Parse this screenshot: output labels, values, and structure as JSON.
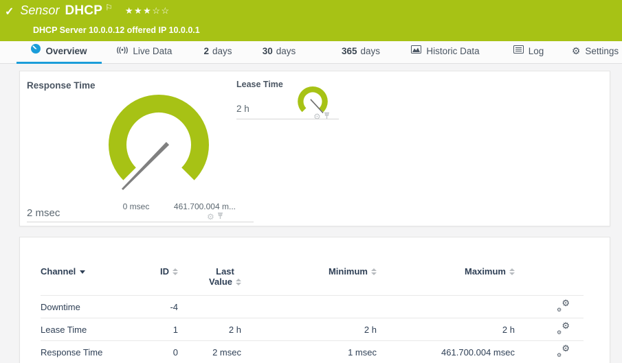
{
  "header": {
    "status_icon": "✓",
    "kind": "Sensor",
    "name": "DHCP",
    "flag_icon": "⚐",
    "stars_filled": "★★★",
    "stars_empty": "☆☆",
    "subtitle": "DHCP Server 10.0.0.12 offered IP 10.0.0.1",
    "status_color": "#a7c215"
  },
  "tabs": {
    "overview": "Overview",
    "live_data": "Live Data",
    "d2_num": "2",
    "d2_label": "days",
    "d30_num": "30",
    "d30_label": "days",
    "d365_num": "365",
    "d365_label": "days",
    "historic": "Historic Data",
    "log": "Log",
    "settings": "Settings",
    "active_tab": "Overview",
    "accent_color": "#1b9dd9"
  },
  "gauges": {
    "response_time": {
      "title": "Response Time",
      "value": "2 msec",
      "scale_min": "0 msec",
      "scale_max": "461.700.004 m...",
      "color": "#a7c215"
    },
    "lease_time": {
      "title": "Lease Time",
      "value": "2 h",
      "color": "#a7c215"
    }
  },
  "channel_table": {
    "headers": {
      "channel": "Channel",
      "id": "ID",
      "last1": "Last",
      "last2": "Value",
      "minimum": "Minimum",
      "maximum": "Maximum"
    },
    "rows": [
      {
        "channel": "Downtime",
        "id": "-4",
        "last": "",
        "min": "",
        "max": ""
      },
      {
        "channel": "Lease Time",
        "id": "1",
        "last": "2 h",
        "min": "2 h",
        "max": "2 h"
      },
      {
        "channel": "Response Time",
        "id": "0",
        "last": "2 msec",
        "min": "1 msec",
        "max": "461.700.004 msec"
      }
    ]
  },
  "icons": {
    "gear": "⚙"
  }
}
